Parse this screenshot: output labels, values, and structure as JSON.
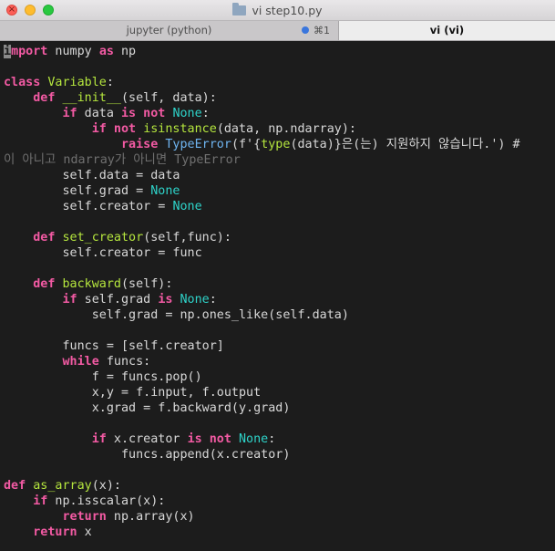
{
  "window": {
    "title": "vi step10.py",
    "folder_icon": "folder-icon",
    "tabs": [
      {
        "label": "jupyter (python)",
        "shortcut": "⌘1",
        "active": false
      },
      {
        "label": "vi (vi)",
        "active": true
      }
    ],
    "close_glyph": "×"
  },
  "colors": {
    "background": "#1c1c1c",
    "keyword": "#f25aa3",
    "builtin": "#6fb4f0",
    "function_name": "#b6e73e",
    "constant": "#2ed3c9",
    "string": "#f2a238",
    "comment": "#707070",
    "text": "#d8d8d8",
    "tab_dot": "#3a76dd"
  },
  "code_lines": [
    [
      [
        "cursor",
        "i"
      ],
      [
        "kw",
        "mport"
      ],
      [
        "tx",
        " numpy "
      ],
      [
        "kw",
        "as"
      ],
      [
        "tx",
        " np"
      ]
    ],
    [],
    [
      [
        "kw",
        "class"
      ],
      [
        "tx",
        " "
      ],
      [
        "fn",
        "Variable"
      ],
      [
        "tx",
        ":"
      ]
    ],
    [
      [
        "tx",
        "    "
      ],
      [
        "kw",
        "def"
      ],
      [
        "tx",
        " "
      ],
      [
        "fn",
        "__init__"
      ],
      [
        "tx",
        "(self, data):"
      ]
    ],
    [
      [
        "tx",
        "        "
      ],
      [
        "kw",
        "if"
      ],
      [
        "tx",
        " data "
      ],
      [
        "kw",
        "is not"
      ],
      [
        "tx",
        " "
      ],
      [
        "co",
        "None"
      ],
      [
        "tx",
        ":"
      ]
    ],
    [
      [
        "tx",
        "            "
      ],
      [
        "kw",
        "if not"
      ],
      [
        "tx",
        " "
      ],
      [
        "fn",
        "isinstance"
      ],
      [
        "tx",
        "(data, np.ndarray):"
      ]
    ],
    [
      [
        "tx",
        "                "
      ],
      [
        "kw",
        "raise"
      ],
      [
        "tx",
        " "
      ],
      [
        "bi",
        "TypeError"
      ],
      [
        "tx",
        "(f'{"
      ],
      [
        "fn",
        "type"
      ],
      [
        "tx",
        "(data)}은(는) 지원하지 않습니다.') #"
      ]
    ],
    [
      [
        "cm",
        "이 아니고 ndarray가 아니면 TypeError"
      ]
    ],
    [
      [
        "tx",
        "        self.data = data"
      ]
    ],
    [
      [
        "tx",
        "        self.grad = "
      ],
      [
        "co",
        "None"
      ]
    ],
    [
      [
        "tx",
        "        self.creator = "
      ],
      [
        "co",
        "None"
      ]
    ],
    [],
    [
      [
        "tx",
        "    "
      ],
      [
        "kw",
        "def"
      ],
      [
        "tx",
        " "
      ],
      [
        "fn",
        "set_creator"
      ],
      [
        "tx",
        "(self,func):"
      ]
    ],
    [
      [
        "tx",
        "        self.creator = func"
      ]
    ],
    [],
    [
      [
        "tx",
        "    "
      ],
      [
        "kw",
        "def"
      ],
      [
        "tx",
        " "
      ],
      [
        "fn",
        "backward"
      ],
      [
        "tx",
        "(self):"
      ]
    ],
    [
      [
        "tx",
        "        "
      ],
      [
        "kw",
        "if"
      ],
      [
        "tx",
        " self.grad "
      ],
      [
        "kw",
        "is"
      ],
      [
        "tx",
        " "
      ],
      [
        "co",
        "None"
      ],
      [
        "tx",
        ":"
      ]
    ],
    [
      [
        "tx",
        "            self.grad = np.ones_like(self.data)"
      ]
    ],
    [],
    [
      [
        "tx",
        "        funcs = [self.creator]"
      ]
    ],
    [
      [
        "tx",
        "        "
      ],
      [
        "kw",
        "while"
      ],
      [
        "tx",
        " funcs:"
      ]
    ],
    [
      [
        "tx",
        "            f = funcs.pop()"
      ]
    ],
    [
      [
        "tx",
        "            x,y = f.input, f.output"
      ]
    ],
    [
      [
        "tx",
        "            x.grad = f.backward(y.grad)"
      ]
    ],
    [],
    [
      [
        "tx",
        "            "
      ],
      [
        "kw",
        "if"
      ],
      [
        "tx",
        " x.creator "
      ],
      [
        "kw",
        "is not"
      ],
      [
        "tx",
        " "
      ],
      [
        "co",
        "None"
      ],
      [
        "tx",
        ":"
      ]
    ],
    [
      [
        "tx",
        "                funcs.append(x.creator)"
      ]
    ],
    [],
    [
      [
        "kw",
        "def"
      ],
      [
        "tx",
        " "
      ],
      [
        "fn",
        "as_array"
      ],
      [
        "tx",
        "(x):"
      ]
    ],
    [
      [
        "tx",
        "    "
      ],
      [
        "kw",
        "if"
      ],
      [
        "tx",
        " np.isscalar(x):"
      ]
    ],
    [
      [
        "tx",
        "        "
      ],
      [
        "kw",
        "return"
      ],
      [
        "tx",
        " np.array(x)"
      ]
    ],
    [
      [
        "tx",
        "    "
      ],
      [
        "kw",
        "return"
      ],
      [
        "tx",
        " x"
      ]
    ]
  ]
}
